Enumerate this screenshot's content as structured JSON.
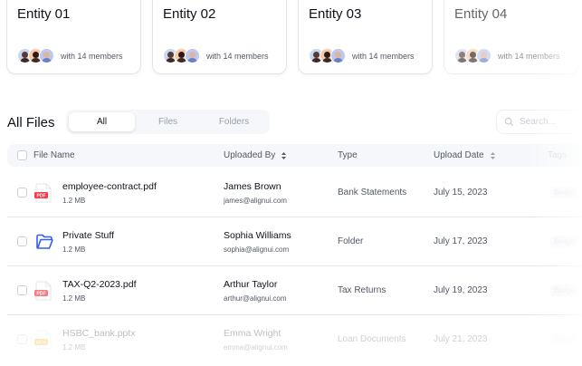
{
  "entities": [
    {
      "name": "Entity 01",
      "members": "with 14 members"
    },
    {
      "name": "Entity 02",
      "members": "with 14 members"
    },
    {
      "name": "Entity 03",
      "members": "with 14 members"
    },
    {
      "name": "Entity 04",
      "members": "with 14 members"
    }
  ],
  "files": {
    "title": "All Files",
    "filters": [
      "All",
      "Files",
      "Folders"
    ],
    "active_filter": "All",
    "search_placeholder": "Search..."
  },
  "table": {
    "columns": [
      "File Name",
      "Uploaded By",
      "Type",
      "Upload Date",
      "Tags"
    ],
    "rows": [
      {
        "icon": "pdf-icon",
        "name": "employee-contract.pdf",
        "size": "1.2 MB",
        "user": "James Brown",
        "email": "james@alignui.com",
        "type": "Bank Statements",
        "date": "July 15, 2023",
        "tag": "Badge"
      },
      {
        "icon": "folder-icon",
        "name": "Private Stuff",
        "size": "1.2 MB",
        "user": "Sophia Williams",
        "email": "sophia@alignui.com",
        "type": "Folder",
        "date": "July 17, 2023",
        "tag": "Badge"
      },
      {
        "icon": "pdf-icon",
        "name": "TAX-Q2-2023.pdf",
        "size": "1.2 MB",
        "user": "Arthur Taylor",
        "email": "arthur@alignui.com",
        "type": "Tax Returns",
        "date": "July 19, 2023",
        "tag": "Badge"
      },
      {
        "icon": "pptx-icon",
        "name": "HSBC_bank.pptx",
        "size": "1.2 MB",
        "user": "Emma Wright",
        "email": "emma@alignui.com",
        "type": "Loan Documents",
        "date": "July 21, 2023",
        "tag": "Badge"
      }
    ]
  },
  "colors": {
    "pdf": "#fb3748",
    "folder": "#335cff",
    "pptx": "#f6b51e"
  }
}
